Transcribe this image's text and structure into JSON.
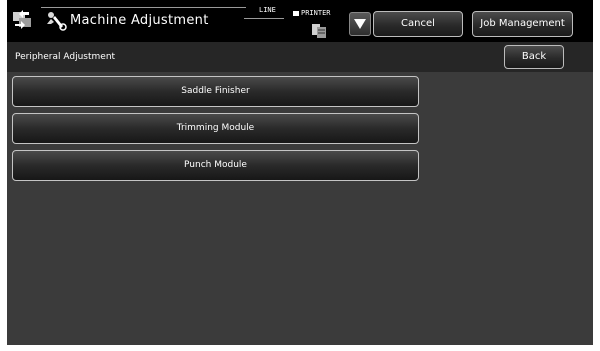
{
  "header": {
    "app_icon": "machine-adjustment-icon",
    "mode_icon": "wrench-person-icon",
    "title": "Machine Adjustment",
    "line_label": "LINE",
    "printer_label": "PRINTER",
    "printer_icon": "printer-job-icon",
    "dropdown_icon": "triangle-down-icon",
    "cancel_label": "Cancel",
    "job_management_label": "Job Management"
  },
  "subheader": {
    "title": "Peripheral Adjustment",
    "back_label": "Back"
  },
  "menu": {
    "items": [
      {
        "label": "Saddle Finisher"
      },
      {
        "label": "Trimming Module"
      },
      {
        "label": "Punch Module"
      }
    ]
  },
  "colors": {
    "background": "#3b3b3b",
    "header": "#000000",
    "subheader": "#262626",
    "button_border": "#c4c4c4",
    "text": "#ffffff"
  }
}
